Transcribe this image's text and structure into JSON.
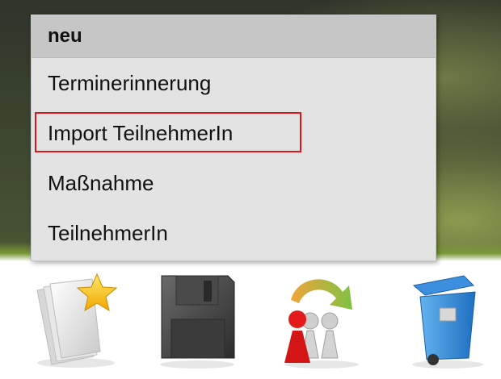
{
  "menu": {
    "header": "neu",
    "items": [
      {
        "label": "Terminerinnerung",
        "highlighted": false
      },
      {
        "label": "Import TeilnehmerIn",
        "highlighted": true
      },
      {
        "label": "Maßnahme",
        "highlighted": false
      },
      {
        "label": "TeilnehmerIn",
        "highlighted": false
      }
    ],
    "highlight_color": "#e0141a"
  },
  "toolbar": {
    "tools": [
      {
        "icon": "new-document-star-icon"
      },
      {
        "icon": "floppy-disk-save-icon"
      },
      {
        "icon": "swap-users-icon"
      },
      {
        "icon": "trash-bin-icon"
      }
    ]
  }
}
